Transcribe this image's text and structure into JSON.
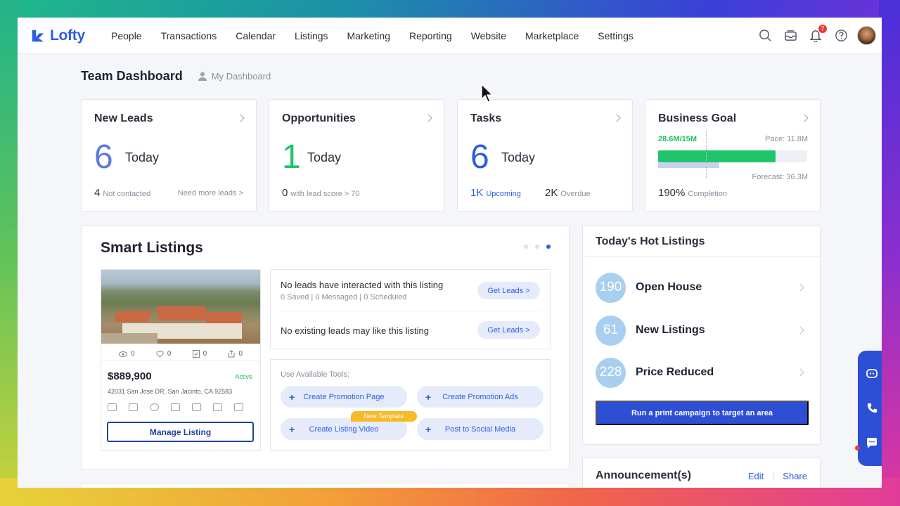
{
  "brand": {
    "name": "Lofty",
    "color": "#2c5de5"
  },
  "nav": {
    "items": [
      "People",
      "Transactions",
      "Calendar",
      "Listings",
      "Marketing",
      "Reporting",
      "Website",
      "Marketplace",
      "Settings"
    ],
    "notification_count": "7",
    "icons": [
      "search-icon",
      "inbox-icon",
      "bell-icon",
      "help-icon",
      "avatar"
    ]
  },
  "header": {
    "title": "Team Dashboard",
    "my_dashboard": "My Dashboard"
  },
  "stats": {
    "new_leads": {
      "title": "New Leads",
      "value": "6",
      "unit": "Today",
      "foot_value": "4",
      "foot_label": "Not contacted",
      "foot_link": "Need more leads >",
      "color": "#5b7be0"
    },
    "opportunities": {
      "title": "Opportunities",
      "value": "1",
      "unit": "Today",
      "foot_value": "0",
      "foot_label": "with lead score > 70",
      "color": "#20c46a"
    },
    "tasks": {
      "title": "Tasks",
      "value": "6",
      "unit": "Today",
      "upcoming_value": "1K",
      "upcoming_label": "Upcoming",
      "overdue_value": "2K",
      "overdue_label": "Overdue",
      "color": "#2c5de5"
    },
    "goal": {
      "title": "Business Goal",
      "progress": "28.6M/15M",
      "pace": "Pace: 11.8M",
      "forecast": "Forecast: 36.3M",
      "completion_value": "190%",
      "completion_label": "Completion",
      "fill_fraction": 0.79,
      "pace_fraction": 0.41
    }
  },
  "smart_listings": {
    "title": "Smart Listings",
    "listing": {
      "views": "0",
      "likes": "0",
      "saves": "0",
      "shares": "0",
      "price": "$889,900",
      "status": "Active",
      "address": "42031 San Jose DR, San Jacinto, CA 92583",
      "manage_label": "Manage Listing"
    },
    "leads": [
      {
        "text": "No leads have interacted with this listing",
        "sub": "0 Saved | 0 Messaged | 0 Scheduled",
        "button": "Get Leads >"
      },
      {
        "text": "No existing leads may like this listing",
        "button": "Get Leads >"
      }
    ],
    "tools_label": "Use Available Tools:",
    "tools": [
      "Create Promotion Page",
      "Create Promotion Ads",
      "Create Listing Video",
      "Post to Social Media"
    ],
    "new_template": "New Template"
  },
  "hot_listings": {
    "title": "Today's Hot Listings",
    "rows": [
      {
        "count": "190",
        "label": "Open House"
      },
      {
        "count": "61",
        "label": "New Listings"
      },
      {
        "count": "228",
        "label": "Price Reduced"
      }
    ],
    "cta": "Run a print campaign to target an area"
  },
  "announcements": {
    "title": "Announcement(s)",
    "edit": "Edit",
    "share": "Share"
  }
}
